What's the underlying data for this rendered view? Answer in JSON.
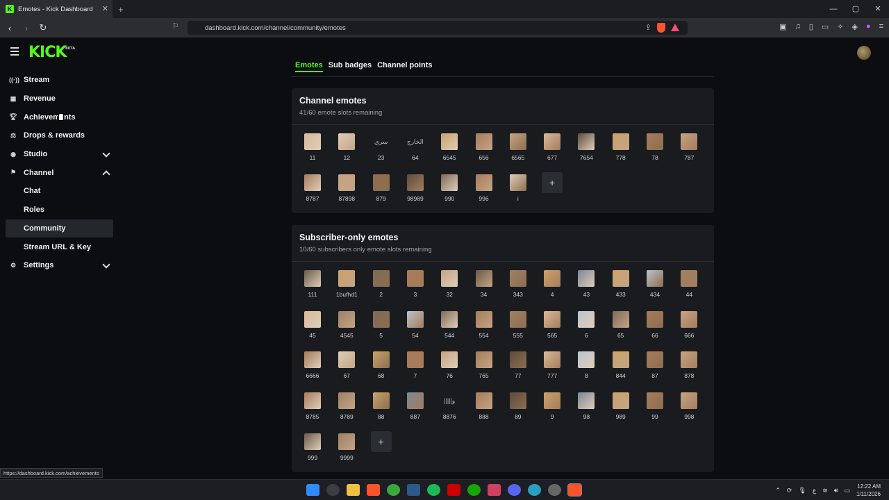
{
  "browser": {
    "tab_title": "Emotes - Kick Dashboard",
    "tab_close": "✕",
    "new_tab": "+",
    "url": "dashboard.kick.com/channel/community/emotes",
    "status_url": "https://dashboard.kick.com/achievements",
    "window_controls": [
      "—",
      "▢",
      "✕"
    ]
  },
  "app": {
    "logo": "KICK",
    "logo_badge": "BETA"
  },
  "sidebar": {
    "items": [
      {
        "label": "Stream",
        "icon": "stream-icon"
      },
      {
        "label": "Revenue",
        "icon": "revenue-icon"
      },
      {
        "label": "Achievements",
        "icon": "trophy-icon"
      },
      {
        "label": "Drops & rewards",
        "icon": "drops-icon"
      },
      {
        "label": "Studio",
        "icon": "studio-icon"
      },
      {
        "label": "Channel",
        "icon": "channel-icon"
      },
      {
        "label": "Chat"
      },
      {
        "label": "Roles"
      },
      {
        "label": "Community"
      },
      {
        "label": "Stream URL & Key"
      },
      {
        "label": "Settings",
        "icon": "gear-icon"
      }
    ]
  },
  "tabs": [
    "Emotes",
    "Sub badges",
    "Channel points"
  ],
  "channel_emotes": {
    "title": "Channel emotes",
    "subtitle": "41/60 emote slots remaining",
    "emotes": [
      "11",
      "12",
      "23",
      "64",
      "6545",
      "656",
      "6565",
      "677",
      "7654",
      "778",
      "78",
      "787",
      "8787",
      "87898",
      "879",
      "98989",
      "990",
      "996",
      "i"
    ]
  },
  "sub_emotes": {
    "title": "Subscriber-only emotes",
    "subtitle": "10/60 subscribers only emote slots remaining",
    "emotes": [
      "111",
      "1bufhd1",
      "2",
      "3",
      "32",
      "34",
      "343",
      "4",
      "43",
      "433",
      "434",
      "44",
      "45",
      "4545",
      "5",
      "54",
      "544",
      "554",
      "555",
      "565",
      "6",
      "65",
      "66",
      "666",
      "6666",
      "67",
      "68",
      "7",
      "76",
      "765",
      "77",
      "777",
      "8",
      "844",
      "87",
      "878",
      "8785",
      "8789",
      "88",
      "887",
      "8876",
      "888",
      "89",
      "9",
      "98",
      "989",
      "99",
      "998",
      "999",
      "9999"
    ]
  },
  "emote_text_images": {
    "23": "سري",
    "64": "الخارج",
    "8876": "|||||و"
  },
  "accent_color": "#53fc18",
  "help_icon": "headset-icon",
  "taskbar": {
    "time": "12:22 AM",
    "date": "1/11/2026",
    "lang": "ع"
  }
}
